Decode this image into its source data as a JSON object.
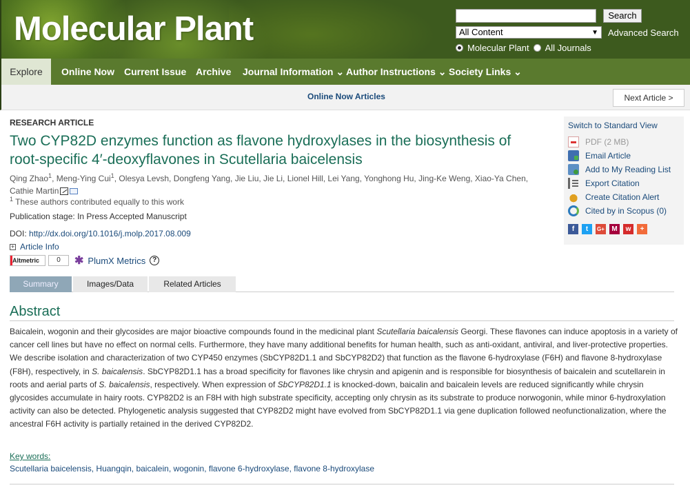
{
  "header": {
    "logo": "Molecular Plant",
    "search_button": "Search",
    "search_value": "",
    "scope_selected": "All Content",
    "advanced_search": "Advanced Search",
    "radio_options": [
      {
        "label": "Molecular Plant",
        "checked": true
      },
      {
        "label": "All Journals",
        "checked": false
      }
    ]
  },
  "nav": {
    "explore": "Explore",
    "items": [
      "Online Now",
      "Current Issue",
      "Archive",
      "Journal Information ⌄",
      "Author Instructions ⌄",
      "Society Links ⌄"
    ]
  },
  "subbar": {
    "section": "Online Now Articles",
    "next_article": "Next Article >"
  },
  "article": {
    "type": "RESEARCH ARTICLE",
    "title": "Two CYP82D enzymes function as flavone hydroxylases in the biosynthesis of root-specific 4′-deoxyflavones in Scutellaria baicelensis",
    "authors_line1_a": "Qing Zhao",
    "authors_line1_b": "Meng-Ying Cui",
    "authors_line1_rest": ", Olesya Levsh, Dongfeng Yang, Jie Liu, Jie Li, Lionel Hill, Lei Yang, Yonghong Hu, Jing-Ke Weng, Xiao-Ya Chen,",
    "authors_line2": "Cathie Martin",
    "sup_mark": "1",
    "equal_contrib": "These authors contributed equally to this work",
    "pub_stage": "Publication stage: In Press Accepted Manuscript",
    "doi_label": "DOI: ",
    "doi_link": "http://dx.doi.org/10.1016/j.molp.2017.08.009",
    "article_info": "Article Info",
    "altmetric_label": "Altmetric",
    "altmetric_count": "0",
    "plumx": "PlumX Metrics",
    "help": "?",
    "tabs": [
      "Summary",
      "Images/Data",
      "Related Articles"
    ],
    "abstract_heading": "Abstract",
    "abstract_p1": "Baicalein, wogonin and their glycosides are major bioactive compounds found in the medicinal plant ",
    "abstract_i1": "Scutellaria baicalensis",
    "abstract_p2": " Georgi. These flavones can induce apoptosis in a variety of cancer cell lines but have no effect on normal cells. Furthermore, they have many additional benefits for human health, such as anti-oxidant, antiviral, and liver-protective properties. We describe isolation and characterization of two CYP450 enzymes (SbCYP82D1.1 and SbCYP82D2) that function as the flavone 6-hydroxylase (F6H) and flavone 8-hydroxylase (F8H), respectively, in ",
    "abstract_i2": "S. baicalensis",
    "abstract_p3": ". SbCYP82D1.1 has a broad specificity for flavones like chrysin and apigenin and is responsible for biosynthesis of baicalein and scutellarein in roots and aerial parts of ",
    "abstract_i3": "S. baicalensis",
    "abstract_p4": ", respectively. When expression of ",
    "abstract_i4": "SbCYP82D1.1",
    "abstract_p5": " is knocked-down, baicalin and baicalein levels are reduced significantly while chrysin glycosides accumulate in hairy roots. CYP82D2 is an F8H with high substrate specificity, accepting only chrysin as its substrate to produce norwogonin, while minor 6-hydroxylation activity can also be detected. Phylogenetic analysis suggested that CYP82D2 might have evolved from SbCYP82D1.1 via gene duplication followed neofunctionalization, where the ancestral F6H activity is partially retained in the derived CYP82D2.",
    "keywords_label": "Key words:",
    "keywords": [
      "Scutellaria baicelensis",
      "Huangqin",
      "baicalein",
      "wogonin",
      "flavone 6-hydroxylase",
      "flavone 8-hydroxylase"
    ],
    "keyword_sep": ", "
  },
  "sidebar": {
    "switch_view": "Switch to Standard View",
    "items": [
      {
        "label": "PDF (2 MB)",
        "icon": "pdf-icon"
      },
      {
        "label": "Email Article",
        "icon": "email-icon"
      },
      {
        "label": "Add to My Reading List",
        "icon": "reading-list-icon"
      },
      {
        "label": "Export Citation",
        "icon": "export-citation-icon"
      },
      {
        "label": "Create Citation Alert",
        "icon": "bell-icon"
      },
      {
        "label": "Cited by in Scopus (0)",
        "icon": "scopus-icon"
      }
    ],
    "social": [
      {
        "name": "facebook-icon",
        "glyph": "f",
        "color": "#3b5998"
      },
      {
        "name": "twitter-icon",
        "glyph": "t",
        "color": "#1da1f2"
      },
      {
        "name": "google-plus-icon",
        "glyph": "G+",
        "color": "#dd4b39"
      },
      {
        "name": "mendeley-icon",
        "glyph": "M",
        "color": "#a5003c"
      },
      {
        "name": "weibo-icon",
        "glyph": "w",
        "color": "#d52b2b"
      },
      {
        "name": "more-share-icon",
        "glyph": "+",
        "color": "#f26b3a"
      }
    ]
  }
}
